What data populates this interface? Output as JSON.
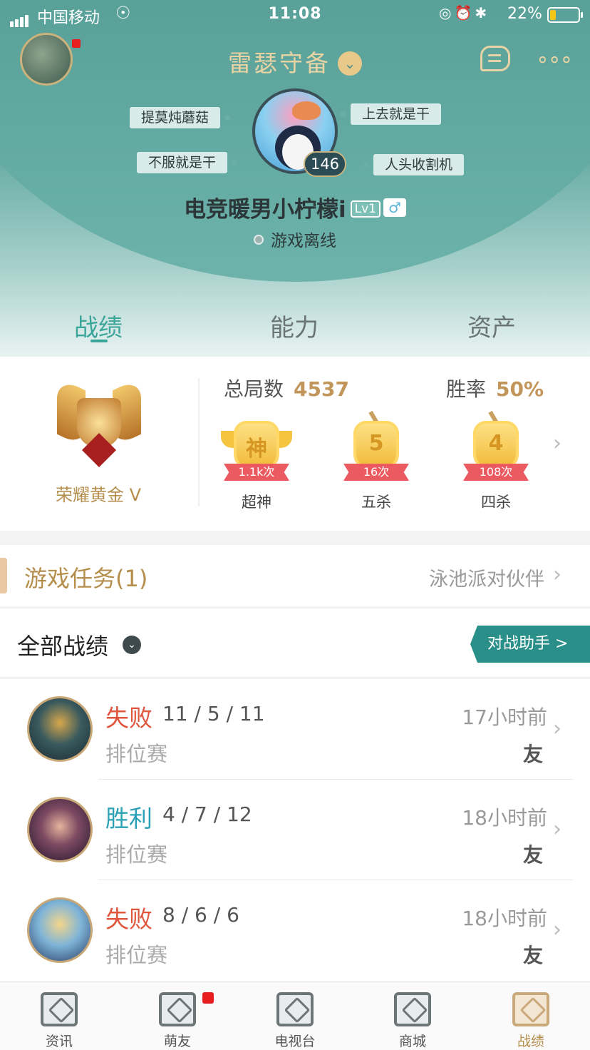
{
  "status_bar": {
    "carrier": "中国移动",
    "time": "11:08",
    "battery": "22%"
  },
  "header": {
    "server": "雷瑟守备",
    "tags": [
      "提莫炖蘑菇",
      "不服就是干",
      "上去就是干",
      "人头收割机"
    ],
    "level": "146",
    "nickname": "电竞暖男小柠檬i",
    "lv_badge": "Lv1",
    "gender_symbol": "♂",
    "online_status": "游戏离线"
  },
  "tabs": [
    "战绩",
    "能力",
    "资产"
  ],
  "stats": {
    "rank_name": "荣耀黄金 V",
    "total_label": "总局数",
    "total_value": "4537",
    "winrate_label": "胜率",
    "winrate_value": "50%",
    "medals": [
      {
        "glyph": "神",
        "count": "1.1k次",
        "label": "超神"
      },
      {
        "glyph": "5",
        "count": "16次",
        "label": "五杀"
      },
      {
        "glyph": "4",
        "count": "108次",
        "label": "四杀"
      }
    ]
  },
  "task": {
    "title": "游戏任务(1)",
    "subtitle": "泳池派对伙伴"
  },
  "records": {
    "title": "全部战绩",
    "assistant_label": "对战助手 >",
    "items": [
      {
        "result": "失败",
        "kda": "11 / 5 / 11",
        "type": "排位赛",
        "time": "17小时前",
        "friend": "友"
      },
      {
        "result": "胜利",
        "kda": "4 / 7 / 12",
        "type": "排位赛",
        "time": "18小时前",
        "friend": "友"
      },
      {
        "result": "失败",
        "kda": "8 / 6 / 6",
        "type": "排位赛",
        "time": "18小时前",
        "friend": "友"
      }
    ]
  },
  "bottom_nav": [
    "资讯",
    "萌友",
    "电视台",
    "商城",
    "战绩"
  ],
  "colors": {
    "accent": "#3ba59a",
    "gold": "#b58e4c",
    "lose": "#e0563c",
    "win": "#2aa1b5"
  }
}
